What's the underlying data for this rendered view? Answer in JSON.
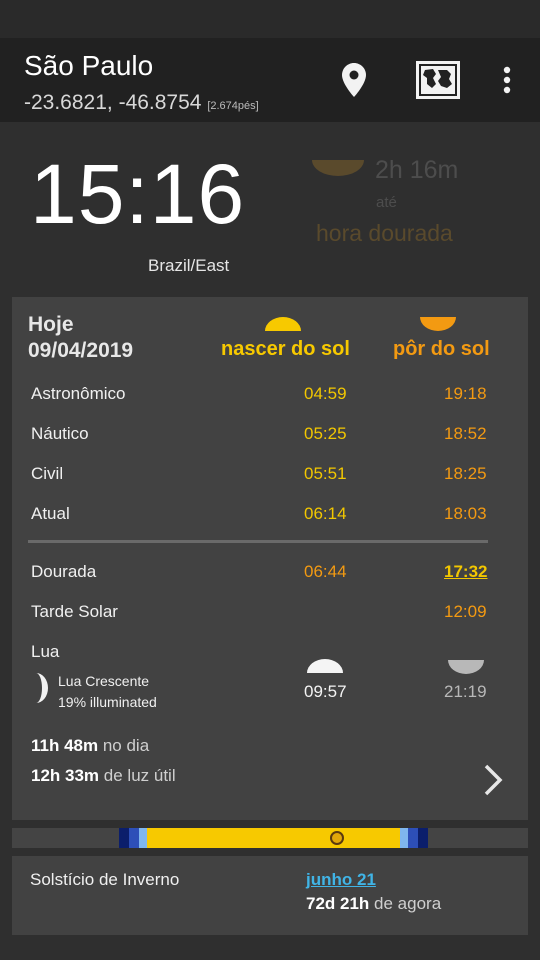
{
  "app": {
    "location_name": "São Paulo",
    "coordinates": "-23.6821, -46.8754",
    "elevation": "[2.674pés]",
    "icons": [
      "location-pin-icon",
      "map-icon",
      "more-vert-icon"
    ]
  },
  "clock": {
    "time": "15:16",
    "timezone": "Brazil/East"
  },
  "countdown": {
    "duration": "2h 16m",
    "until_word": "até",
    "event": "hora dourada"
  },
  "card": {
    "day_label": "Hoje",
    "date": "09/04/2019",
    "sunrise_header": "nascer do sol",
    "sunset_header": "pôr do sol",
    "rows": [
      {
        "label": "Astronômico",
        "rise": "04:59",
        "set": "19:18"
      },
      {
        "label": "Náutico",
        "rise": "05:25",
        "set": "18:52"
      },
      {
        "label": "Civil",
        "rise": "05:51",
        "set": "18:25"
      },
      {
        "label": "Atual",
        "rise": "06:14",
        "set": "18:03"
      }
    ],
    "golden": {
      "label": "Dourada",
      "rise": "06:44",
      "set": "17:32"
    },
    "noon": {
      "label": "Tarde Solar",
      "time": "12:09"
    },
    "moon": {
      "label": "Lua",
      "phase": "Lua Crescente",
      "illumination": "19% illuminated",
      "rise": "09:57",
      "set": "21:19"
    },
    "day_length": {
      "value": "11h 48m",
      "suffix": "no dia"
    },
    "light_length": {
      "value": "12h 33m",
      "suffix": "de luz útil"
    }
  },
  "colors": {
    "sunrise": "#f7c900",
    "sunset": "#f39a12",
    "link": "#40b4e6",
    "card": "#424242",
    "appbar": "#212121"
  },
  "timeline": {
    "current_fraction": 0.63
  },
  "solstice": {
    "label": "Solstício de Inverno",
    "date": "junho 21",
    "countdown_value": "72d 21h",
    "countdown_suffix": "de agora"
  }
}
